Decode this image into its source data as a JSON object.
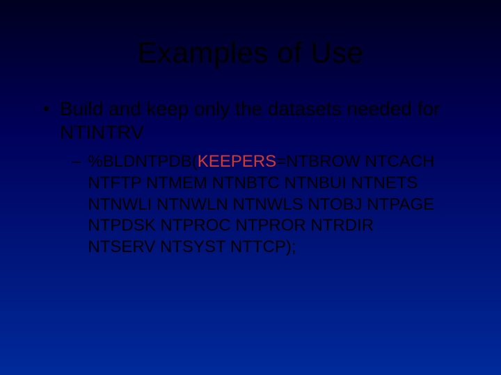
{
  "title": "Examples of Use",
  "bullet": {
    "text": "Build and keep only the datasets needed for NTINTRV"
  },
  "sub": {
    "dash": "–",
    "pre": "%BLDNTPDB(",
    "keyword": "KEEPERS",
    "post": "=NTBROW NTCACH NTFTP NTMEM NTNBTC NTNBUI NTNETS NTNWLI NTNWLN NTNWLS NTOBJ NTPAGE NTPDSK NTPROC NTPROR NTRDIR NTSERV NTSYST NTTCP);"
  }
}
